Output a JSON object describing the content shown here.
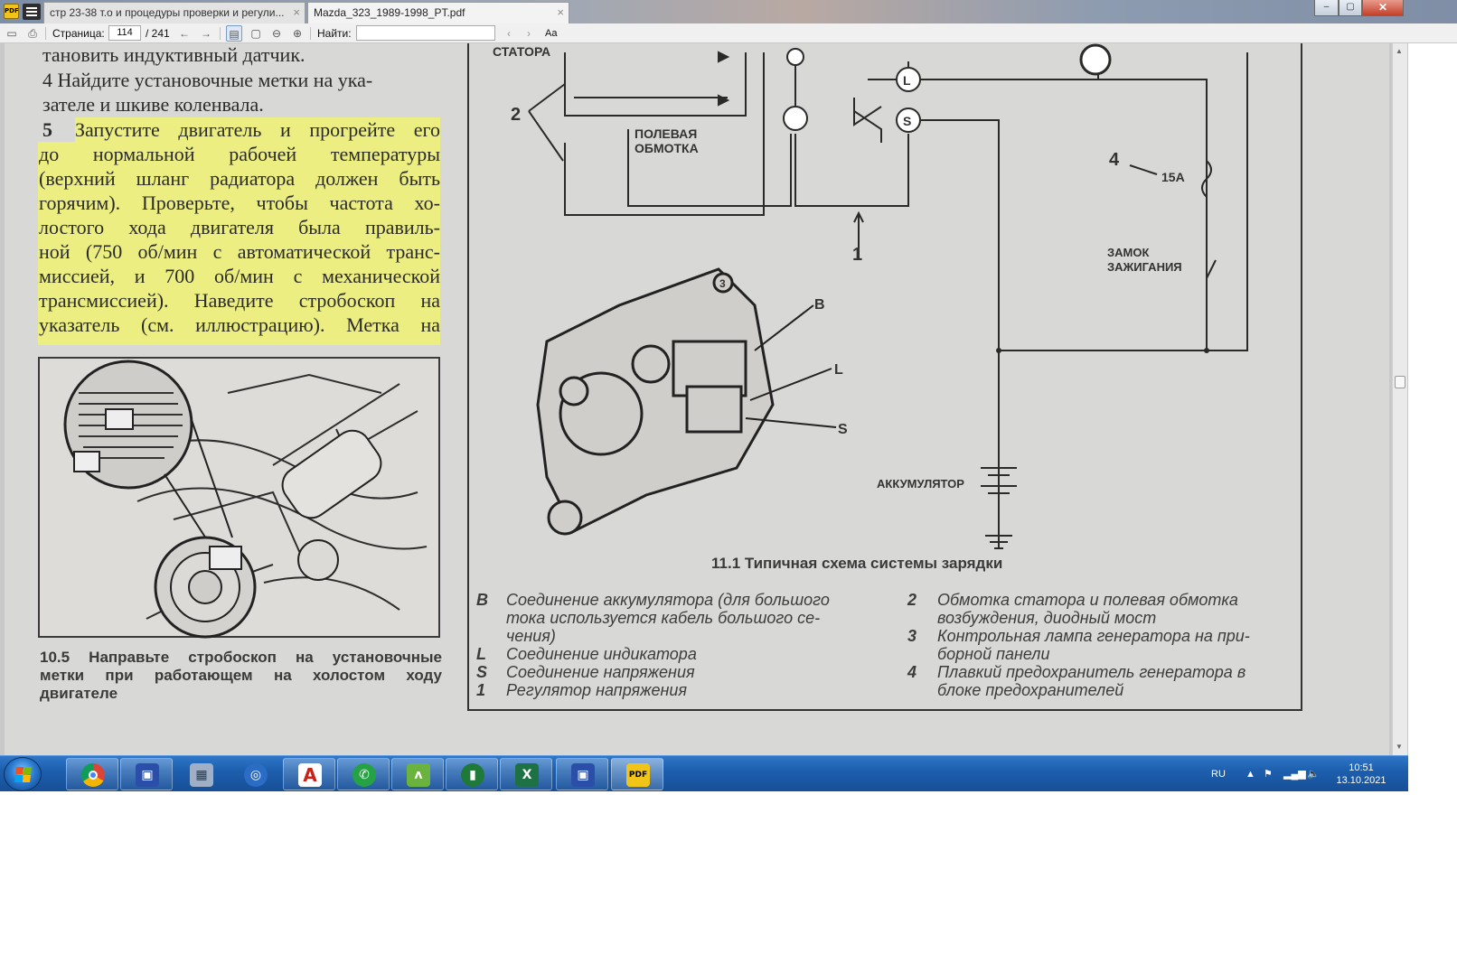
{
  "window": {
    "app_logo_text": "PDF",
    "tabs": [
      {
        "label": "стр 23-38 т.о и процедуры проверки и регули...",
        "active": false
      },
      {
        "label": "Mazda_323_1989-1998_PT.pdf",
        "active": true
      }
    ],
    "close_glyph": "×",
    "controls": {
      "minimize": "–",
      "maximize": "▢",
      "close": "✕"
    }
  },
  "toolbar": {
    "page_label": "Страница:",
    "page_current": "114",
    "page_total": "/ 241",
    "find_label": "Найти:",
    "find_value": "",
    "font_toggle": "Aa",
    "icons": [
      "folder-icon",
      "print-icon",
      "arrow-left-icon",
      "arrow-right-icon",
      "single-page-icon",
      "page-fit-icon",
      "zoom-out-icon",
      "zoom-in-icon",
      "find-prev-icon",
      "find-next-icon"
    ]
  },
  "page": {
    "lines": [
      "тановить индуктивный датчик.",
      "4   Найдите установочные метки на ука-",
      "зателе и шкиве коленвала."
    ],
    "step5_number": "5",
    "step5_lines": [
      "Запустите двигатель и прогрейте его",
      "до нормальной рабочей температуры",
      "(верхний шланг радиатора должен быть",
      "горячим). Проверьте, чтобы частота хо-",
      "лостого хода двигателя была правиль-",
      "ной (750 об/мин с автоматической транс-",
      "миссией, и 700 об/мин с механической",
      "трансмиссией). Наведите стробоскоп на",
      "указатель (см. иллюстрацию). Метка на"
    ],
    "figure_10_5_caption": [
      "10.5 Направьте стробоскоп на установочные",
      "метки при работающем на холостом ходу",
      "двигателе"
    ],
    "diagram_labels": {
      "stator": "СТАТОРА",
      "field_winding_1": "ПОЛЕВАЯ",
      "field_winding_2": "ОБМОТКА",
      "num_2": "2",
      "num_1": "1",
      "num_4": "4",
      "fuse": "15A",
      "ignition_1": "ЗАМОК",
      "ignition_2": "ЗАЖИГАНИЯ",
      "battery": "АККУМУЛЯТОР",
      "term_L": "L",
      "term_S": "S",
      "lead_B": "B",
      "lead_L": "L",
      "lead_S": "S",
      "bolt_3": "3"
    },
    "figure_11_1_caption": "11.1 Типичная схема системы зарядки",
    "legend_left": [
      {
        "key": "B",
        "lines": [
          "Соединение аккумулятора (для большого",
          "тока используется кабель большого се-",
          "чения)"
        ]
      },
      {
        "key": "L",
        "lines": [
          "Соединение индикатора"
        ]
      },
      {
        "key": "S",
        "lines": [
          "Соединение напряжения"
        ]
      },
      {
        "key": "1",
        "lines": [
          "Регулятор напряжения"
        ]
      }
    ],
    "legend_right": [
      {
        "key": "2",
        "lines": [
          "Обмотка статора и полевая обмотка",
          "возбуждения, диодный мост"
        ]
      },
      {
        "key": "3",
        "lines": [
          "Контрольная лампа генератора на при-",
          "борной панели"
        ]
      },
      {
        "key": "4",
        "lines": [
          "Плавкий предохранитель генератора в",
          "блоке предохранителей"
        ]
      }
    ]
  },
  "taskbar": {
    "apps": [
      {
        "name": "chrome",
        "glyph": "●",
        "color": "#d93025"
      },
      {
        "name": "save-app",
        "glyph": "▣",
        "color": "#2b4fa8"
      },
      {
        "name": "calculator",
        "glyph": "▦",
        "color": "#7e8ea3"
      },
      {
        "name": "blue-circle-app",
        "glyph": "◎",
        "color": "#2b6cc4"
      },
      {
        "name": "acrobat",
        "glyph": "A",
        "color": "#c8231b"
      },
      {
        "name": "whatsapp",
        "glyph": "✆",
        "color": "#25a244"
      },
      {
        "name": "green-leaf-app",
        "glyph": "ʌ",
        "color": "#4a9a2a"
      },
      {
        "name": "chart-app",
        "glyph": "▮",
        "color": "#1f7a3a"
      },
      {
        "name": "excel",
        "glyph": "X",
        "color": "#1e7145"
      },
      {
        "name": "save-app-2",
        "glyph": "▣",
        "color": "#2b4fa8"
      },
      {
        "name": "pdf-viewer",
        "glyph": "PDF",
        "color": "#f0c419"
      }
    ],
    "language": "RU",
    "time": "10:51",
    "date": "13.10.2021"
  }
}
